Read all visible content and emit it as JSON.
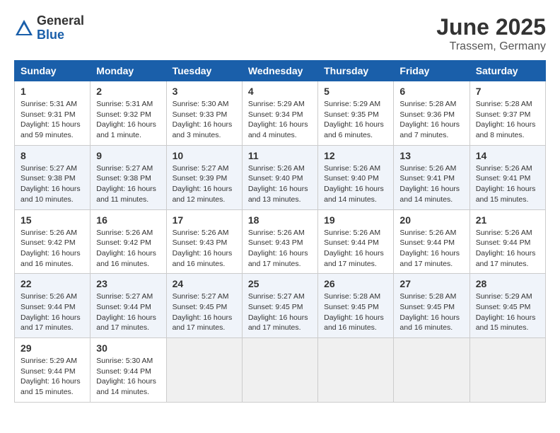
{
  "header": {
    "logo_general": "General",
    "logo_blue": "Blue",
    "month_title": "June 2025",
    "location": "Trassem, Germany"
  },
  "columns": [
    "Sunday",
    "Monday",
    "Tuesday",
    "Wednesday",
    "Thursday",
    "Friday",
    "Saturday"
  ],
  "weeks": [
    [
      {
        "day": "1",
        "info": "Sunrise: 5:31 AM\nSunset: 9:31 PM\nDaylight: 15 hours\nand 59 minutes."
      },
      {
        "day": "2",
        "info": "Sunrise: 5:31 AM\nSunset: 9:32 PM\nDaylight: 16 hours\nand 1 minute."
      },
      {
        "day": "3",
        "info": "Sunrise: 5:30 AM\nSunset: 9:33 PM\nDaylight: 16 hours\nand 3 minutes."
      },
      {
        "day": "4",
        "info": "Sunrise: 5:29 AM\nSunset: 9:34 PM\nDaylight: 16 hours\nand 4 minutes."
      },
      {
        "day": "5",
        "info": "Sunrise: 5:29 AM\nSunset: 9:35 PM\nDaylight: 16 hours\nand 6 minutes."
      },
      {
        "day": "6",
        "info": "Sunrise: 5:28 AM\nSunset: 9:36 PM\nDaylight: 16 hours\nand 7 minutes."
      },
      {
        "day": "7",
        "info": "Sunrise: 5:28 AM\nSunset: 9:37 PM\nDaylight: 16 hours\nand 8 minutes."
      }
    ],
    [
      {
        "day": "8",
        "info": "Sunrise: 5:27 AM\nSunset: 9:38 PM\nDaylight: 16 hours\nand 10 minutes."
      },
      {
        "day": "9",
        "info": "Sunrise: 5:27 AM\nSunset: 9:38 PM\nDaylight: 16 hours\nand 11 minutes."
      },
      {
        "day": "10",
        "info": "Sunrise: 5:27 AM\nSunset: 9:39 PM\nDaylight: 16 hours\nand 12 minutes."
      },
      {
        "day": "11",
        "info": "Sunrise: 5:26 AM\nSunset: 9:40 PM\nDaylight: 16 hours\nand 13 minutes."
      },
      {
        "day": "12",
        "info": "Sunrise: 5:26 AM\nSunset: 9:40 PM\nDaylight: 16 hours\nand 14 minutes."
      },
      {
        "day": "13",
        "info": "Sunrise: 5:26 AM\nSunset: 9:41 PM\nDaylight: 16 hours\nand 14 minutes."
      },
      {
        "day": "14",
        "info": "Sunrise: 5:26 AM\nSunset: 9:41 PM\nDaylight: 16 hours\nand 15 minutes."
      }
    ],
    [
      {
        "day": "15",
        "info": "Sunrise: 5:26 AM\nSunset: 9:42 PM\nDaylight: 16 hours\nand 16 minutes."
      },
      {
        "day": "16",
        "info": "Sunrise: 5:26 AM\nSunset: 9:42 PM\nDaylight: 16 hours\nand 16 minutes."
      },
      {
        "day": "17",
        "info": "Sunrise: 5:26 AM\nSunset: 9:43 PM\nDaylight: 16 hours\nand 16 minutes."
      },
      {
        "day": "18",
        "info": "Sunrise: 5:26 AM\nSunset: 9:43 PM\nDaylight: 16 hours\nand 17 minutes."
      },
      {
        "day": "19",
        "info": "Sunrise: 5:26 AM\nSunset: 9:44 PM\nDaylight: 16 hours\nand 17 minutes."
      },
      {
        "day": "20",
        "info": "Sunrise: 5:26 AM\nSunset: 9:44 PM\nDaylight: 16 hours\nand 17 minutes."
      },
      {
        "day": "21",
        "info": "Sunrise: 5:26 AM\nSunset: 9:44 PM\nDaylight: 16 hours\nand 17 minutes."
      }
    ],
    [
      {
        "day": "22",
        "info": "Sunrise: 5:26 AM\nSunset: 9:44 PM\nDaylight: 16 hours\nand 17 minutes."
      },
      {
        "day": "23",
        "info": "Sunrise: 5:27 AM\nSunset: 9:44 PM\nDaylight: 16 hours\nand 17 minutes."
      },
      {
        "day": "24",
        "info": "Sunrise: 5:27 AM\nSunset: 9:45 PM\nDaylight: 16 hours\nand 17 minutes."
      },
      {
        "day": "25",
        "info": "Sunrise: 5:27 AM\nSunset: 9:45 PM\nDaylight: 16 hours\nand 17 minutes."
      },
      {
        "day": "26",
        "info": "Sunrise: 5:28 AM\nSunset: 9:45 PM\nDaylight: 16 hours\nand 16 minutes."
      },
      {
        "day": "27",
        "info": "Sunrise: 5:28 AM\nSunset: 9:45 PM\nDaylight: 16 hours\nand 16 minutes."
      },
      {
        "day": "28",
        "info": "Sunrise: 5:29 AM\nSunset: 9:45 PM\nDaylight: 16 hours\nand 15 minutes."
      }
    ],
    [
      {
        "day": "29",
        "info": "Sunrise: 5:29 AM\nSunset: 9:44 PM\nDaylight: 16 hours\nand 15 minutes."
      },
      {
        "day": "30",
        "info": "Sunrise: 5:30 AM\nSunset: 9:44 PM\nDaylight: 16 hours\nand 14 minutes."
      },
      {
        "day": "",
        "info": ""
      },
      {
        "day": "",
        "info": ""
      },
      {
        "day": "",
        "info": ""
      },
      {
        "day": "",
        "info": ""
      },
      {
        "day": "",
        "info": ""
      }
    ]
  ]
}
